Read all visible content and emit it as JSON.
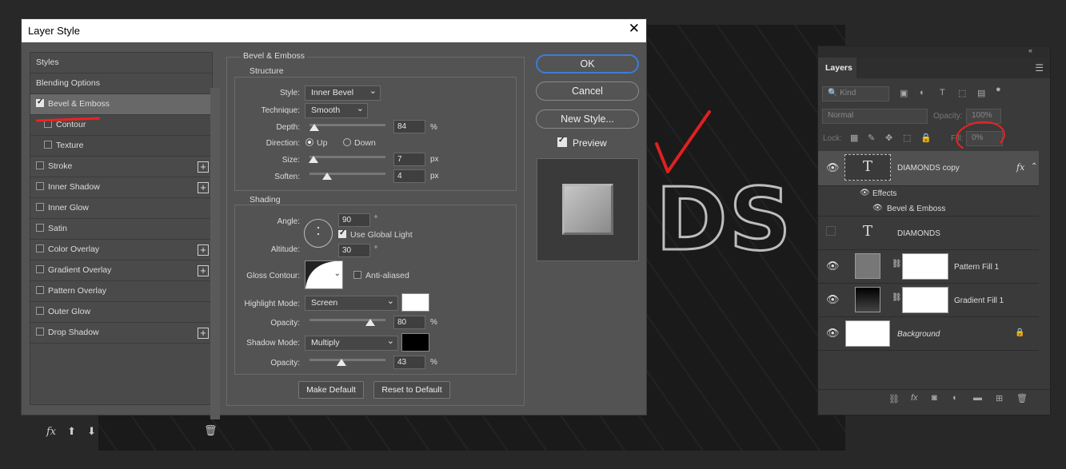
{
  "dialog": {
    "title": "Layer Style",
    "left_items": [
      {
        "label": "Styles"
      },
      {
        "label": "Blending Options"
      },
      {
        "label": "Bevel & Emboss",
        "checked": true
      },
      {
        "label": "Contour",
        "checked": false
      },
      {
        "label": "Texture",
        "checked": false
      },
      {
        "label": "Stroke",
        "checked": false
      },
      {
        "label": "Inner Shadow",
        "checked": false
      },
      {
        "label": "Inner Glow",
        "checked": false
      },
      {
        "label": "Satin",
        "checked": false
      },
      {
        "label": "Color Overlay",
        "checked": false
      },
      {
        "label": "Gradient Overlay",
        "checked": false
      },
      {
        "label": "Pattern Overlay",
        "checked": false
      },
      {
        "label": "Outer Glow",
        "checked": false
      },
      {
        "label": "Drop Shadow",
        "checked": false
      }
    ],
    "fx_label": "fx",
    "bevel": {
      "section_title": "Bevel & Emboss",
      "structure_title": "Structure",
      "style_label": "Style:",
      "style_value": "Inner Bevel",
      "technique_label": "Technique:",
      "technique_value": "Smooth",
      "depth_label": "Depth:",
      "depth_value": "84",
      "depth_unit": "%",
      "direction_label": "Direction:",
      "dir_up": "Up",
      "dir_down": "Down",
      "size_label": "Size:",
      "size_value": "7",
      "size_unit": "px",
      "soften_label": "Soften:",
      "soften_value": "4",
      "soften_unit": "px",
      "shading_title": "Shading",
      "angle_label": "Angle:",
      "angle_value": "90",
      "angle_unit": "°",
      "global_light": "Use Global Light",
      "altitude_label": "Altitude:",
      "altitude_value": "30",
      "altitude_unit": "°",
      "gloss_label": "Gloss Contour:",
      "anti_aliased": "Anti-aliased",
      "highlight_label": "Highlight Mode:",
      "highlight_value": "Screen",
      "h_opacity_label": "Opacity:",
      "h_opacity_value": "80",
      "h_opacity_unit": "%",
      "shadow_label": "Shadow Mode:",
      "shadow_value": "Multiply",
      "s_opacity_label": "Opacity:",
      "s_opacity_value": "43",
      "s_opacity_unit": "%",
      "make_default": "Make Default",
      "reset_default": "Reset to Default",
      "highlight_color": "#ffffff",
      "shadow_color": "#000000"
    },
    "buttons": {
      "ok": "OK",
      "cancel": "Cancel",
      "new_style": "New Style...",
      "preview": "Preview"
    }
  },
  "canvas": {
    "letters": "DS"
  },
  "layers": {
    "collapse": "«",
    "tab": "Layers",
    "filter_kind": "Kind",
    "blend_mode": "Normal",
    "opacity_label": "Opacity:",
    "opacity_value": "100%",
    "lock_label": "Lock:",
    "fill_label": "Fill:",
    "fill_value": "0%",
    "items": [
      {
        "name": "DIAMONDS copy",
        "fx": "fx"
      },
      {
        "name": "Effects"
      },
      {
        "name": "Bevel & Emboss"
      },
      {
        "name": "DIAMONDS"
      },
      {
        "name": "Pattern Fill 1"
      },
      {
        "name": "Gradient Fill 1"
      },
      {
        "name": "Background"
      }
    ]
  }
}
